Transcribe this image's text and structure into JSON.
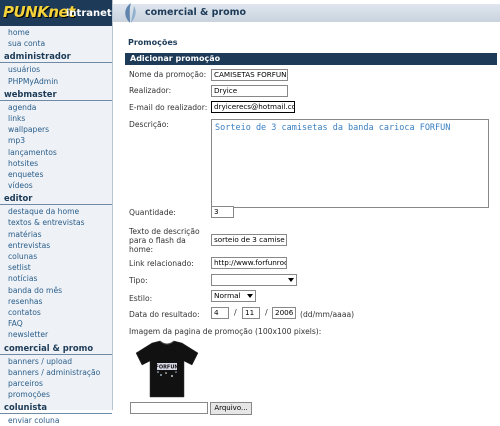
{
  "logo": {
    "brand": "PUNKnet",
    "sub": "intranet"
  },
  "sidebar": {
    "top_links": [
      "home",
      "sua conta"
    ],
    "sections": [
      {
        "title": "administrador",
        "links": [
          "usuários",
          "PHPMyAdmin"
        ]
      },
      {
        "title": "webmaster",
        "links": [
          "agenda",
          "links",
          "wallpapers",
          "mp3",
          "lançamentos",
          "hotsites",
          "enquetes",
          "vídeos"
        ]
      },
      {
        "title": "editor",
        "links": [
          "destaque da home",
          "textos & entrevistas",
          "matérias",
          "entrevistas",
          "colunas",
          "setlist",
          "notícias",
          "banda do mês",
          "resenhas",
          "contatos",
          "FAQ",
          "newsletter"
        ]
      },
      {
        "title": "comercial & promo",
        "links": [
          "banners / upload",
          "banners / administração",
          "parceiros",
          "promoções"
        ]
      },
      {
        "title": "colunista",
        "links": [
          "enviar coluna"
        ]
      }
    ]
  },
  "header": {
    "title": "comercial & promo"
  },
  "page": {
    "section_title": "Promoções",
    "panel_title": "Adicionar promoção"
  },
  "form": {
    "nome_label": "Nome da promoção:",
    "nome_value": "CAMISETAS FORFUN",
    "realizador_label": "Realizador:",
    "realizador_value": "Dryice",
    "email_label": "E-mail do realizador:",
    "email_value": "dryicerecs@hotmail.com",
    "descricao_label": "Descrição:",
    "descricao_value": "Sorteio de 3 camisetas da banda carioca FORFUN",
    "quantidade_label": "Quantidade:",
    "quantidade_value": "3",
    "flash_label_1": "Texto de descrição",
    "flash_label_2": "para o flash da",
    "flash_label_3": "home:",
    "flash_value": "sorteio de 3 camise",
    "link_label": "Link relacionado:",
    "link_value": "http://www.forfunroc",
    "tipo_label": "Tipo:",
    "tipo_value": "",
    "estilo_label": "Estilo:",
    "estilo_value": "Normal",
    "data_label": "Data do resultado:",
    "data_day": "4",
    "data_month": "11",
    "data_year": "2006",
    "data_sep": "/",
    "data_format": "(dd/mm/aaaa)",
    "imagem_label": "Imagem da pagina de promoção (100x100 pixels):",
    "file_button": "Arquivo..."
  },
  "colors": {
    "navy": "#1d3b58",
    "link": "#2a5d8a",
    "accent": "#f4d23a"
  }
}
